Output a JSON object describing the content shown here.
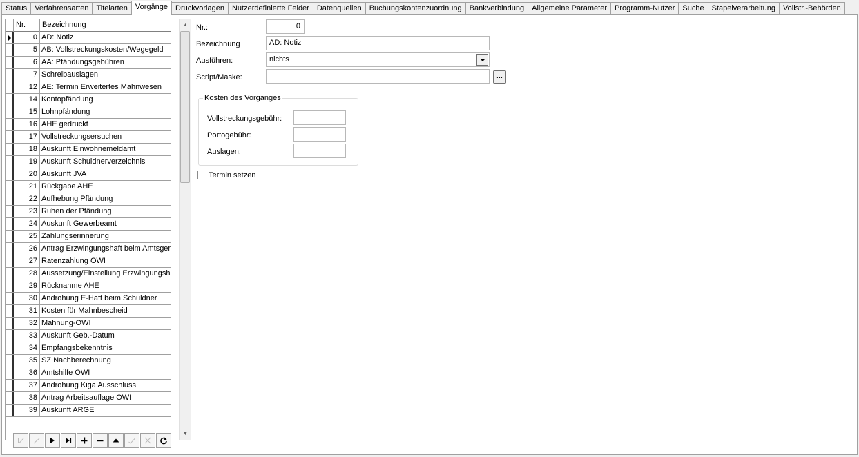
{
  "tabs": [
    "Status",
    "Verfahrensarten",
    "Titelarten",
    "Vorgänge",
    "Druckvorlagen",
    "Nutzerdefinierte Felder",
    "Datenquellen",
    "Buchungskontenzuordnung",
    "Bankverbindung",
    "Allgemeine Parameter",
    "Programm-Nutzer",
    "Suche",
    "Stapelverarbeitung",
    "Vollstr.-Behörden"
  ],
  "active_tab": "Vorgänge",
  "grid": {
    "columns": [
      "Nr.",
      "Bezeichnung"
    ],
    "rows": [
      {
        "nr": "0",
        "bez": "AD: Notiz"
      },
      {
        "nr": "5",
        "bez": "AB: Vollstreckungskosten/Wegegeld"
      },
      {
        "nr": "6",
        "bez": "AA: Pfändungsgebühren"
      },
      {
        "nr": "7",
        "bez": "Schreibauslagen"
      },
      {
        "nr": "12",
        "bez": "AE: Termin Erweitertes Mahnwesen"
      },
      {
        "nr": "14",
        "bez": "Kontopfändung"
      },
      {
        "nr": "15",
        "bez": "Lohnpfändung"
      },
      {
        "nr": "16",
        "bez": "AHE gedruckt"
      },
      {
        "nr": "17",
        "bez": "Vollstreckungsersuchen"
      },
      {
        "nr": "18",
        "bez": "Auskunft Einwohnemeldamt"
      },
      {
        "nr": "19",
        "bez": "Auskunft Schuldnerverzeichnis"
      },
      {
        "nr": "20",
        "bez": "Auskunft JVA"
      },
      {
        "nr": "21",
        "bez": "Rückgabe AHE"
      },
      {
        "nr": "22",
        "bez": "Aufhebung Pfändung"
      },
      {
        "nr": "23",
        "bez": "Ruhen der Pfändung"
      },
      {
        "nr": "24",
        "bez": "Auskunft Gewerbeamt"
      },
      {
        "nr": "25",
        "bez": "Zahlungserinnerung"
      },
      {
        "nr": "26",
        "bez": "Antrag Erzwingungshaft beim Amtsgericht"
      },
      {
        "nr": "27",
        "bez": "Ratenzahlung OWI"
      },
      {
        "nr": "28",
        "bez": "Aussetzung/Einstellung Erzwingungshaft"
      },
      {
        "nr": "29",
        "bez": "Rücknahme AHE"
      },
      {
        "nr": "30",
        "bez": "Androhung E-Haft beim Schuldner"
      },
      {
        "nr": "31",
        "bez": "Kosten für  Mahnbescheid"
      },
      {
        "nr": "32",
        "bez": "Mahnung-OWI"
      },
      {
        "nr": "33",
        "bez": "Auskunft Geb.-Datum"
      },
      {
        "nr": "34",
        "bez": "Empfangsbekenntnis"
      },
      {
        "nr": "35",
        "bez": "SZ Nachberechnung"
      },
      {
        "nr": "36",
        "bez": "Amtshilfe OWI"
      },
      {
        "nr": "37",
        "bez": "Androhung Kiga Ausschluss"
      },
      {
        "nr": "38",
        "bez": "Antrag Arbeitsauflage OWI"
      },
      {
        "nr": "39",
        "bez": "Auskunft ARGE"
      }
    ]
  },
  "form": {
    "nr_label": "Nr.:",
    "nr_value": "0",
    "bez_label": "Bezeichnung",
    "bez_value": "AD: Notiz",
    "ausfuehren_label": "Ausführen:",
    "ausfuehren_value": "nichts",
    "script_label": "Script/Maske:",
    "script_value": "",
    "browse_label": "...",
    "kosten_title": "Kosten des Vorganges",
    "vollstreckung_label": "Vollstreckungsgebühr:",
    "vollstreckung_value": "",
    "porto_label": "Portogebühr:",
    "porto_value": "",
    "auslagen_label": "Auslagen:",
    "auslagen_value": "",
    "termin_label": "Termin setzen",
    "termin_checked": false
  },
  "navigator": [
    "first",
    "prior",
    "next",
    "last",
    "insert",
    "delete",
    "edit",
    "post",
    "cancel",
    "refresh"
  ]
}
